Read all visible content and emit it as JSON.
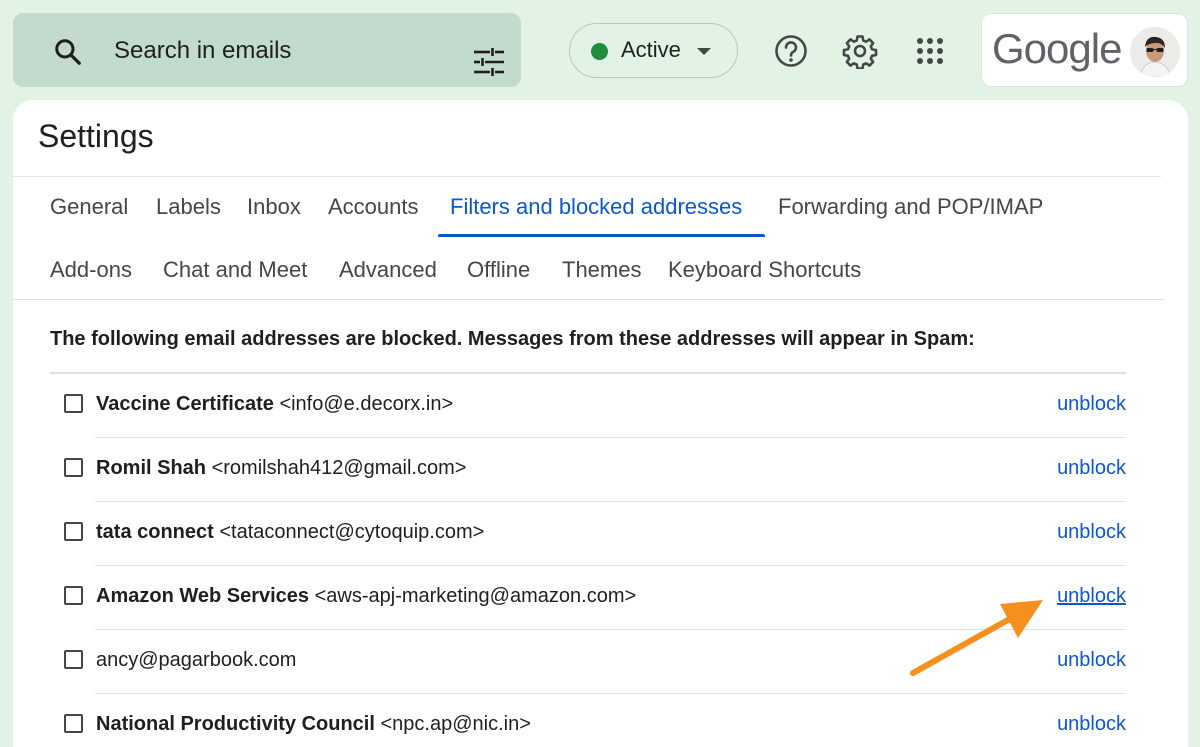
{
  "search": {
    "placeholder": "Search in emails"
  },
  "status": {
    "label": "Active",
    "dot_color": "#1e8e3e"
  },
  "account": {
    "logo_text": "Google"
  },
  "settings": {
    "title": "Settings",
    "tabs_row1": [
      "General",
      "Labels",
      "Inbox",
      "Accounts",
      "Filters and blocked addresses",
      "Forwarding and POP/IMAP"
    ],
    "tabs_row2": [
      "Add-ons",
      "Chat and Meet",
      "Advanced",
      "Offline",
      "Themes",
      "Keyboard Shortcuts"
    ],
    "active_tab": "Filters and blocked addresses",
    "blocked_heading": "The following email addresses are blocked. Messages from these addresses will appear in Spam:",
    "blocked": [
      {
        "name": "Vaccine Certificate",
        "email": "<info@e.decorx.in>",
        "action": "unblock"
      },
      {
        "name": "Romil Shah",
        "email": "<romilshah412@gmail.com>",
        "action": "unblock"
      },
      {
        "name": "tata connect",
        "email": "<tataconnect@cytoquip.com>",
        "action": "unblock"
      },
      {
        "name": "Amazon Web Services",
        "email": "<aws-apj-marketing@amazon.com>",
        "action": "unblock"
      },
      {
        "name": "",
        "email": "ancy@pagarbook.com",
        "action": "unblock"
      },
      {
        "name": "National Productivity Council",
        "email": "<npc.ap@nic.in>",
        "action": "unblock"
      }
    ]
  },
  "colors": {
    "accent": "#0b57d0",
    "background": "#e2f3e6",
    "annotation_arrow": "#f5901e"
  }
}
